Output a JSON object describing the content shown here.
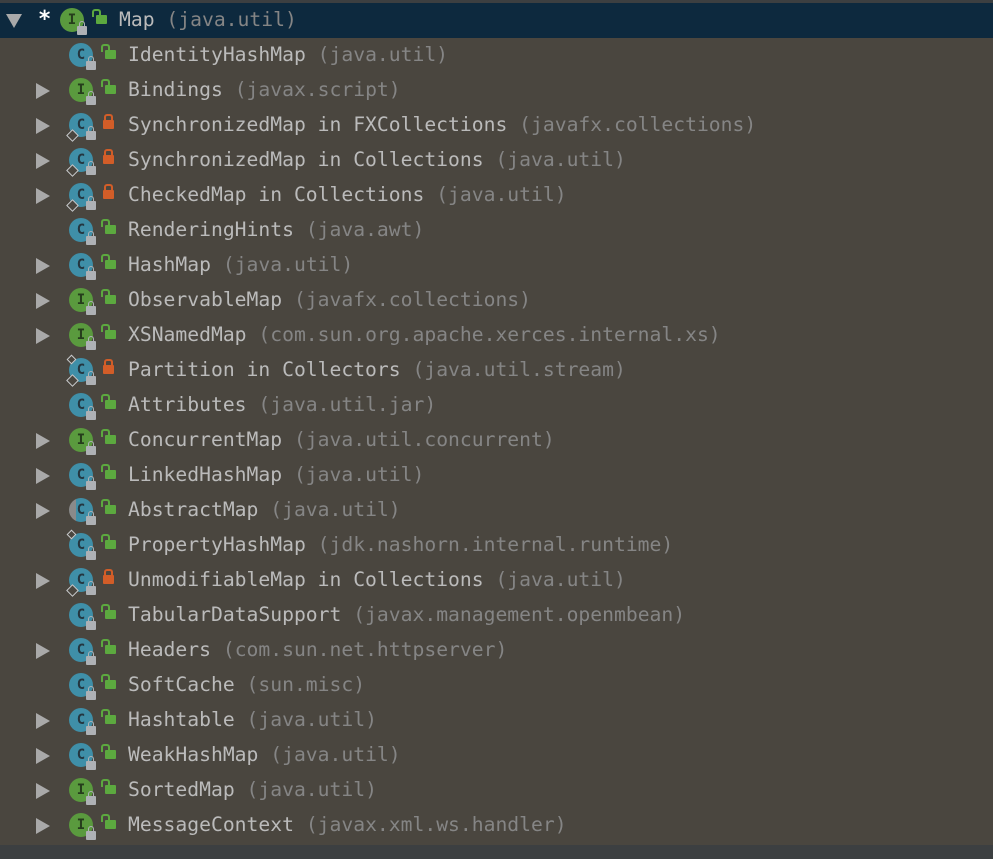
{
  "root": {
    "name": "Map",
    "package": "(java.util)",
    "kind": "interface",
    "access": "public",
    "expanded": true,
    "marker": "*"
  },
  "colors": {
    "selection": "#0d293e",
    "interface": "#5a9a3e",
    "class": "#3f8fa8",
    "public": "#5ca93f",
    "private": "#d25d28"
  },
  "items": [
    {
      "name": "IdentityHashMap",
      "package": "(java.util)",
      "kind": "class",
      "access": "public",
      "expandable": false
    },
    {
      "name": "Bindings",
      "package": "(javax.script)",
      "kind": "interface",
      "access": "public",
      "expandable": true
    },
    {
      "name": "SynchronizedMap in FXCollections",
      "package": "(javafx.collections)",
      "kind": "class",
      "access": "private",
      "static": true,
      "expandable": true
    },
    {
      "name": "SynchronizedMap in Collections",
      "package": "(java.util)",
      "kind": "class",
      "access": "private",
      "static": true,
      "expandable": true
    },
    {
      "name": "CheckedMap in Collections",
      "package": "(java.util)",
      "kind": "class",
      "access": "private",
      "static": true,
      "expandable": true
    },
    {
      "name": "RenderingHints",
      "package": "(java.awt)",
      "kind": "class",
      "access": "public",
      "expandable": false
    },
    {
      "name": "HashMap",
      "package": "(java.util)",
      "kind": "class",
      "access": "public",
      "expandable": true
    },
    {
      "name": "ObservableMap",
      "package": "(javafx.collections)",
      "kind": "interface",
      "access": "public",
      "expandable": true
    },
    {
      "name": "XSNamedMap",
      "package": "(com.sun.org.apache.xerces.internal.xs)",
      "kind": "interface",
      "access": "public",
      "expandable": true
    },
    {
      "name": "Partition in Collectors",
      "package": "(java.util.stream)",
      "kind": "class",
      "access": "private",
      "static": true,
      "final": true,
      "expandable": false
    },
    {
      "name": "Attributes",
      "package": "(java.util.jar)",
      "kind": "class",
      "access": "public",
      "expandable": false
    },
    {
      "name": "ConcurrentMap",
      "package": "(java.util.concurrent)",
      "kind": "interface",
      "access": "public",
      "expandable": true
    },
    {
      "name": "LinkedHashMap",
      "package": "(java.util)",
      "kind": "class",
      "access": "public",
      "expandable": true
    },
    {
      "name": "AbstractMap",
      "package": "(java.util)",
      "kind": "abstract",
      "access": "public",
      "expandable": true
    },
    {
      "name": "PropertyHashMap",
      "package": "(jdk.nashorn.internal.runtime)",
      "kind": "class",
      "access": "public",
      "final": true,
      "expandable": false
    },
    {
      "name": "UnmodifiableMap in Collections",
      "package": "(java.util)",
      "kind": "class",
      "access": "private",
      "static": true,
      "expandable": true
    },
    {
      "name": "TabularDataSupport",
      "package": "(javax.management.openmbean)",
      "kind": "class",
      "access": "public",
      "expandable": false
    },
    {
      "name": "Headers",
      "package": "(com.sun.net.httpserver)",
      "kind": "class",
      "access": "public",
      "expandable": true
    },
    {
      "name": "SoftCache",
      "package": "(sun.misc)",
      "kind": "class",
      "access": "public",
      "expandable": false
    },
    {
      "name": "Hashtable",
      "package": "(java.util)",
      "kind": "class",
      "access": "public",
      "expandable": true
    },
    {
      "name": "WeakHashMap",
      "package": "(java.util)",
      "kind": "class",
      "access": "public",
      "expandable": true
    },
    {
      "name": "SortedMap",
      "package": "(java.util)",
      "kind": "interface",
      "access": "public",
      "expandable": true
    },
    {
      "name": "MessageContext",
      "package": "(javax.xml.ws.handler)",
      "kind": "interface",
      "access": "public",
      "expandable": true
    }
  ]
}
